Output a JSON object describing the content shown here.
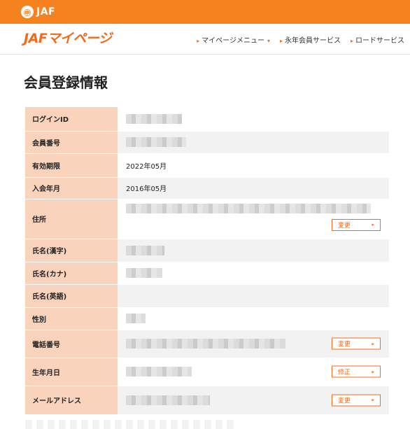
{
  "topbar": {
    "seal": "JAF",
    "brand": "JAF"
  },
  "header": {
    "logo": "JAFマイページ",
    "nav": [
      {
        "label": "マイページメニュー"
      },
      {
        "label": "永年会員サービス"
      },
      {
        "label": "ロードサービス"
      }
    ]
  },
  "page": {
    "title": "会員登録情報"
  },
  "rows": [
    {
      "label": "ログインID",
      "value": "",
      "button": ""
    },
    {
      "label": "会員番号",
      "value": "",
      "button": ""
    },
    {
      "label": "有効期限",
      "value": "2022年05月",
      "button": ""
    },
    {
      "label": "入会年月",
      "value": "2016年05月",
      "button": ""
    },
    {
      "label": "住所",
      "value": "",
      "button": "変更"
    },
    {
      "label": "氏名(漢字)",
      "value": "",
      "button": ""
    },
    {
      "label": "氏名(カナ)",
      "value": "",
      "button": ""
    },
    {
      "label": "氏名(英語)",
      "value": "",
      "button": ""
    },
    {
      "label": "性別",
      "value": "",
      "button": ""
    },
    {
      "label": "電話番号",
      "value": "",
      "button": "変更"
    },
    {
      "label": "生年月日",
      "value": "",
      "button": "修正"
    },
    {
      "label": "メールアドレス",
      "value": "",
      "button": "変更"
    }
  ],
  "colors": {
    "brand_orange": "#f5821f",
    "label_bg": "#fad3bd",
    "button_border": "#f26b1d"
  }
}
